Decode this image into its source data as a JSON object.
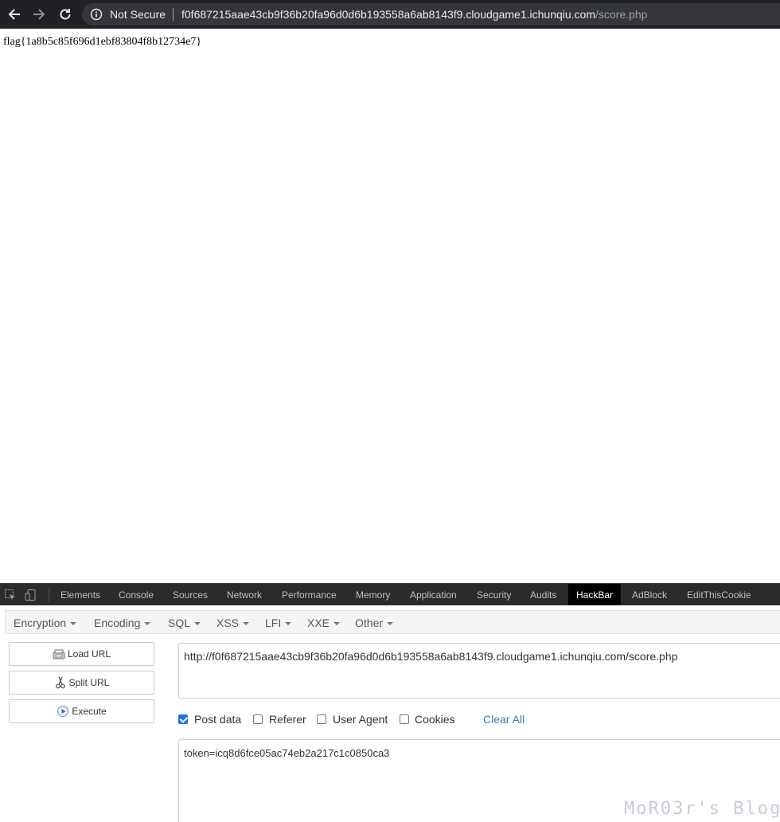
{
  "browser": {
    "security_label": "Not Secure",
    "url_host": "f0f687215aae43cb9f36b20fa96d0d6b193558a6ab8143f9.cloudgame1.ichunqiu.com",
    "url_path": "/score.php"
  },
  "page": {
    "flag_text": "flag{1a8b5c85f696d1ebf83804f8b12734e7}"
  },
  "devtools": {
    "tabs": [
      "Elements",
      "Console",
      "Sources",
      "Network",
      "Performance",
      "Memory",
      "Application",
      "Security",
      "Audits",
      "HackBar",
      "AdBlock",
      "EditThisCookie"
    ],
    "active_tab": "HackBar"
  },
  "hackbar": {
    "menu": [
      "Encryption",
      "Encoding",
      "SQL",
      "XSS",
      "LFI",
      "XXE",
      "Other"
    ],
    "buttons": {
      "load_url": "Load URL",
      "split_url": "Split URL",
      "execute": "Execute"
    },
    "url_value": "http://f0f687215aae43cb9f36b20fa96d0d6b193558a6ab8143f9.cloudgame1.ichunqiu.com/score.php",
    "options": {
      "post_data": {
        "label": "Post data",
        "checked": true
      },
      "referer": {
        "label": "Referer",
        "checked": false
      },
      "user_agent": {
        "label": "User Agent",
        "checked": false
      },
      "cookies": {
        "label": "Cookies",
        "checked": false
      }
    },
    "clear_all": "Clear All",
    "post_value": "token=icq8d6fce05ac74eb2a217c1c0850ca3"
  },
  "watermark": "MoR03r's Blog",
  "colors": {
    "browser_bar": "#202124",
    "devtools_bar": "#2b2b2b",
    "link": "#337ab7",
    "checkbox_checked": "#1a73e8"
  }
}
